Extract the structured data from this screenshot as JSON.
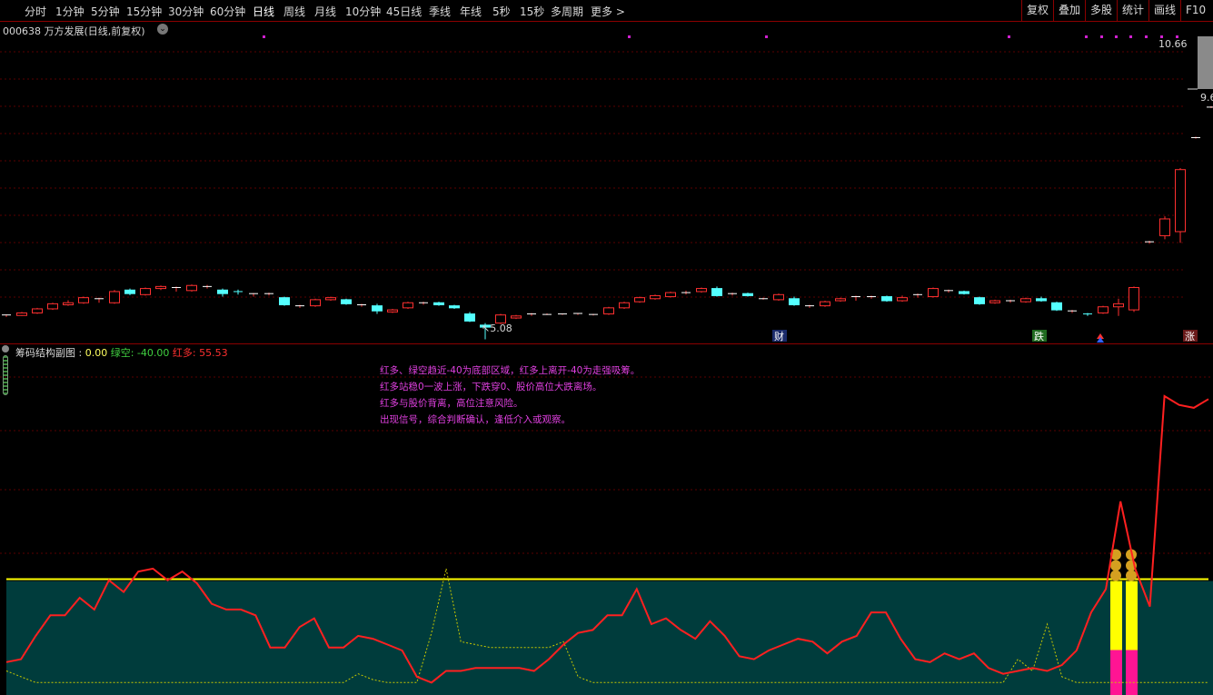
{
  "toolbar": {
    "tabs": [
      "分时",
      "1分钟",
      "5分钟",
      "15分钟",
      "30分钟",
      "60分钟",
      "日线",
      "周线",
      "月线",
      "10分钟",
      "45日线",
      "季线",
      "年线",
      "5秒",
      "15秒",
      "多周期",
      "更多 >"
    ],
    "active_tab": "日线",
    "right_buttons": [
      "复权",
      "叠加",
      "多股",
      "统计",
      "画线",
      "F10"
    ]
  },
  "stock": {
    "title": "000638 万方发展(日线,前复权)",
    "price_high_label": "10.66",
    "price_right_label": "9.6",
    "low_label": "5.08"
  },
  "markers": {
    "cai": "财",
    "die": "跌",
    "zhang": "涨"
  },
  "indicator": {
    "name": "筹码结构副图",
    "sep": " : ",
    "zero_value": "0.00",
    "green_label": "绿空",
    "green_value": "-40.00",
    "red_label": "红多",
    "red_value": "55.53",
    "notes": [
      "红多、绿空趋近-40为底部区域，红多上离开-40为走强吸筹。",
      "红多站稳0一波上涨，下跌穿0、股价高位大跌离场。",
      "红多与股价背离，高位注意风险。",
      "出现信号，综合判断确认，逢低介入或观察。"
    ]
  },
  "colors": {
    "up": "#ff3030",
    "down": "#54ffff",
    "red_line": "#ff2020",
    "green_line": "#c8c800",
    "zone_fill": "#003c3c",
    "yellow_line": "#ffff00",
    "magenta_dot": "#d020d0",
    "grid": "#5a0000"
  },
  "chart_data": [
    {
      "type": "candlestick",
      "title": "000638 万方发展(日线,前复权)",
      "annotations": [
        "10.66",
        "9.6",
        "5.08"
      ],
      "note": "OHLC in price units, left to right",
      "ohlc": [
        [
          5.55,
          5.57,
          5.52,
          5.56
        ],
        [
          5.55,
          5.62,
          5.54,
          5.6
        ],
        [
          5.6,
          5.7,
          5.58,
          5.68
        ],
        [
          5.68,
          5.8,
          5.66,
          5.78
        ],
        [
          5.76,
          5.85,
          5.74,
          5.8
        ],
        [
          5.8,
          5.92,
          5.78,
          5.9
        ],
        [
          5.88,
          5.9,
          5.8,
          5.88
        ],
        [
          5.8,
          6.05,
          5.78,
          6.02
        ],
        [
          6.05,
          6.08,
          5.95,
          5.98
        ],
        [
          5.96,
          6.1,
          5.94,
          6.08
        ],
        [
          6.08,
          6.14,
          6.05,
          6.12
        ],
        [
          6.1,
          6.12,
          6.02,
          6.1
        ],
        [
          6.04,
          6.16,
          6.02,
          6.14
        ],
        [
          6.12,
          6.15,
          6.08,
          6.12
        ],
        [
          6.05,
          6.08,
          5.92,
          5.98
        ],
        [
          6.02,
          6.06,
          5.96,
          6.0
        ],
        [
          5.96,
          5.99,
          5.92,
          5.98
        ],
        [
          5.98,
          6.0,
          5.94,
          5.98
        ],
        [
          5.9,
          5.92,
          5.74,
          5.76
        ],
        [
          5.72,
          5.76,
          5.7,
          5.74
        ],
        [
          5.74,
          5.88,
          5.72,
          5.86
        ],
        [
          5.86,
          5.92,
          5.84,
          5.9
        ],
        [
          5.86,
          5.88,
          5.76,
          5.78
        ],
        [
          5.74,
          5.78,
          5.72,
          5.76
        ],
        [
          5.74,
          5.78,
          5.58,
          5.64
        ],
        [
          5.62,
          5.68,
          5.6,
          5.66
        ],
        [
          5.7,
          5.82,
          5.68,
          5.8
        ],
        [
          5.78,
          5.82,
          5.76,
          5.8
        ],
        [
          5.8,
          5.82,
          5.74,
          5.76
        ],
        [
          5.74,
          5.76,
          5.68,
          5.7
        ],
        [
          5.58,
          5.62,
          5.42,
          5.44
        ],
        [
          5.36,
          5.4,
          5.08,
          5.32
        ],
        [
          5.4,
          5.58,
          5.38,
          5.56
        ],
        [
          5.5,
          5.56,
          5.48,
          5.54
        ],
        [
          5.56,
          5.6,
          5.54,
          5.58
        ],
        [
          5.57,
          5.59,
          5.56,
          5.57
        ],
        [
          5.57,
          5.59,
          5.56,
          5.58
        ],
        [
          5.58,
          5.6,
          5.56,
          5.59
        ],
        [
          5.56,
          5.58,
          5.55,
          5.57
        ],
        [
          5.58,
          5.72,
          5.56,
          5.7
        ],
        [
          5.7,
          5.82,
          5.68,
          5.8
        ],
        [
          5.82,
          5.92,
          5.8,
          5.9
        ],
        [
          5.88,
          5.96,
          5.86,
          5.94
        ],
        [
          5.92,
          6.02,
          5.9,
          6.0
        ],
        [
          5.98,
          6.04,
          5.96,
          6.0
        ],
        [
          6.02,
          6.1,
          6.0,
          6.08
        ],
        [
          6.08,
          6.12,
          5.92,
          5.94
        ],
        [
          5.96,
          6.0,
          5.94,
          5.98
        ],
        [
          5.98,
          6.0,
          5.92,
          5.94
        ],
        [
          5.88,
          5.9,
          5.86,
          5.88
        ],
        [
          5.86,
          5.98,
          5.84,
          5.96
        ],
        [
          5.88,
          5.92,
          5.74,
          5.76
        ],
        [
          5.72,
          5.76,
          5.7,
          5.74
        ],
        [
          5.74,
          5.84,
          5.72,
          5.82
        ],
        [
          5.84,
          5.9,
          5.82,
          5.88
        ],
        [
          5.9,
          5.94,
          5.84,
          5.92
        ],
        [
          5.9,
          5.94,
          5.88,
          5.92
        ],
        [
          5.92,
          5.94,
          5.82,
          5.84
        ],
        [
          5.84,
          5.94,
          5.82,
          5.9
        ],
        [
          5.94,
          5.98,
          5.9,
          5.96
        ],
        [
          5.92,
          6.1,
          5.9,
          6.08
        ],
        [
          6.02,
          6.06,
          6.0,
          6.04
        ],
        [
          6.02,
          6.04,
          5.96,
          5.98
        ],
        [
          5.9,
          5.92,
          5.76,
          5.78
        ],
        [
          5.8,
          5.86,
          5.78,
          5.84
        ],
        [
          5.84,
          5.86,
          5.8,
          5.84
        ],
        [
          5.82,
          5.9,
          5.8,
          5.88
        ],
        [
          5.88,
          5.92,
          5.82,
          5.84
        ],
        [
          5.8,
          5.82,
          5.64,
          5.66
        ],
        [
          5.62,
          5.66,
          5.6,
          5.64
        ],
        [
          5.58,
          5.6,
          5.54,
          5.56
        ],
        [
          5.6,
          5.74,
          5.58,
          5.72
        ],
        [
          5.72,
          5.88,
          5.54,
          5.78
        ],
        [
          5.66,
          6.12,
          5.62,
          6.1
        ],
        [
          7.0,
          7.02,
          6.96,
          7.0
        ],
        [
          7.12,
          7.5,
          7.05,
          7.45
        ],
        [
          7.2,
          8.45,
          6.98,
          8.42
        ],
        [
          9.05,
          9.07,
          9.03,
          9.05
        ],
        [
          9.65,
          9.67,
          9.63,
          9.65
        ],
        [
          10.62,
          10.66,
          10.6,
          10.64
        ]
      ]
    },
    {
      "type": "line",
      "title": "筹码结构副图",
      "ylim": [
        -45,
        70
      ],
      "series": [
        {
          "name": "红多",
          "values": [
            -35,
            -34,
            -26,
            -19,
            -19,
            -13,
            -17,
            -7,
            -11,
            -4,
            -3,
            -7,
            -4,
            -8,
            -15,
            -17,
            -17,
            -19,
            -30,
            -30,
            -23,
            -20,
            -30,
            -30,
            -26,
            -27,
            -29,
            -31,
            -40,
            -42,
            -38,
            -38,
            -37,
            -37,
            -37,
            -37,
            -38,
            -34,
            -29,
            -25,
            -24,
            -19,
            -19,
            -10,
            -22,
            -20,
            -24,
            -27,
            -21,
            -26,
            -33,
            -34,
            -31,
            -29,
            -27,
            -28,
            -32,
            -28,
            -26,
            -18,
            -18,
            -27,
            -34,
            -35,
            -32,
            -34,
            -32,
            -37,
            -39,
            -38,
            -37,
            -38,
            -36,
            -31,
            -18,
            -10,
            20,
            -3,
            -16,
            56,
            53,
            52,
            55
          ]
        },
        {
          "name": "绿空",
          "values": [
            -38,
            -40,
            -42,
            -42,
            -42,
            -42,
            -42,
            -42,
            -42,
            -42,
            -42,
            -42,
            -42,
            -42,
            -42,
            -42,
            -42,
            -42,
            -42,
            -42,
            -42,
            -42,
            -42,
            -42,
            -39,
            -41,
            -42,
            -42,
            -42,
            -25,
            -3,
            -28,
            -29,
            -30,
            -30,
            -30,
            -30,
            -30,
            -28,
            -40,
            -42,
            -42,
            -42,
            -42,
            -42,
            -42,
            -42,
            -42,
            -42,
            -42,
            -42,
            -42,
            -42,
            -42,
            -42,
            -42,
            -42,
            -42,
            -42,
            -42,
            -42,
            -42,
            -42,
            -42,
            -42,
            -42,
            -42,
            -42,
            -42,
            -34,
            -38,
            -22,
            -40,
            -42,
            -42,
            -42,
            -42,
            -42,
            -42,
            -42,
            -42,
            -42,
            -42
          ]
        }
      ],
      "signal_bars": 2
    }
  ]
}
